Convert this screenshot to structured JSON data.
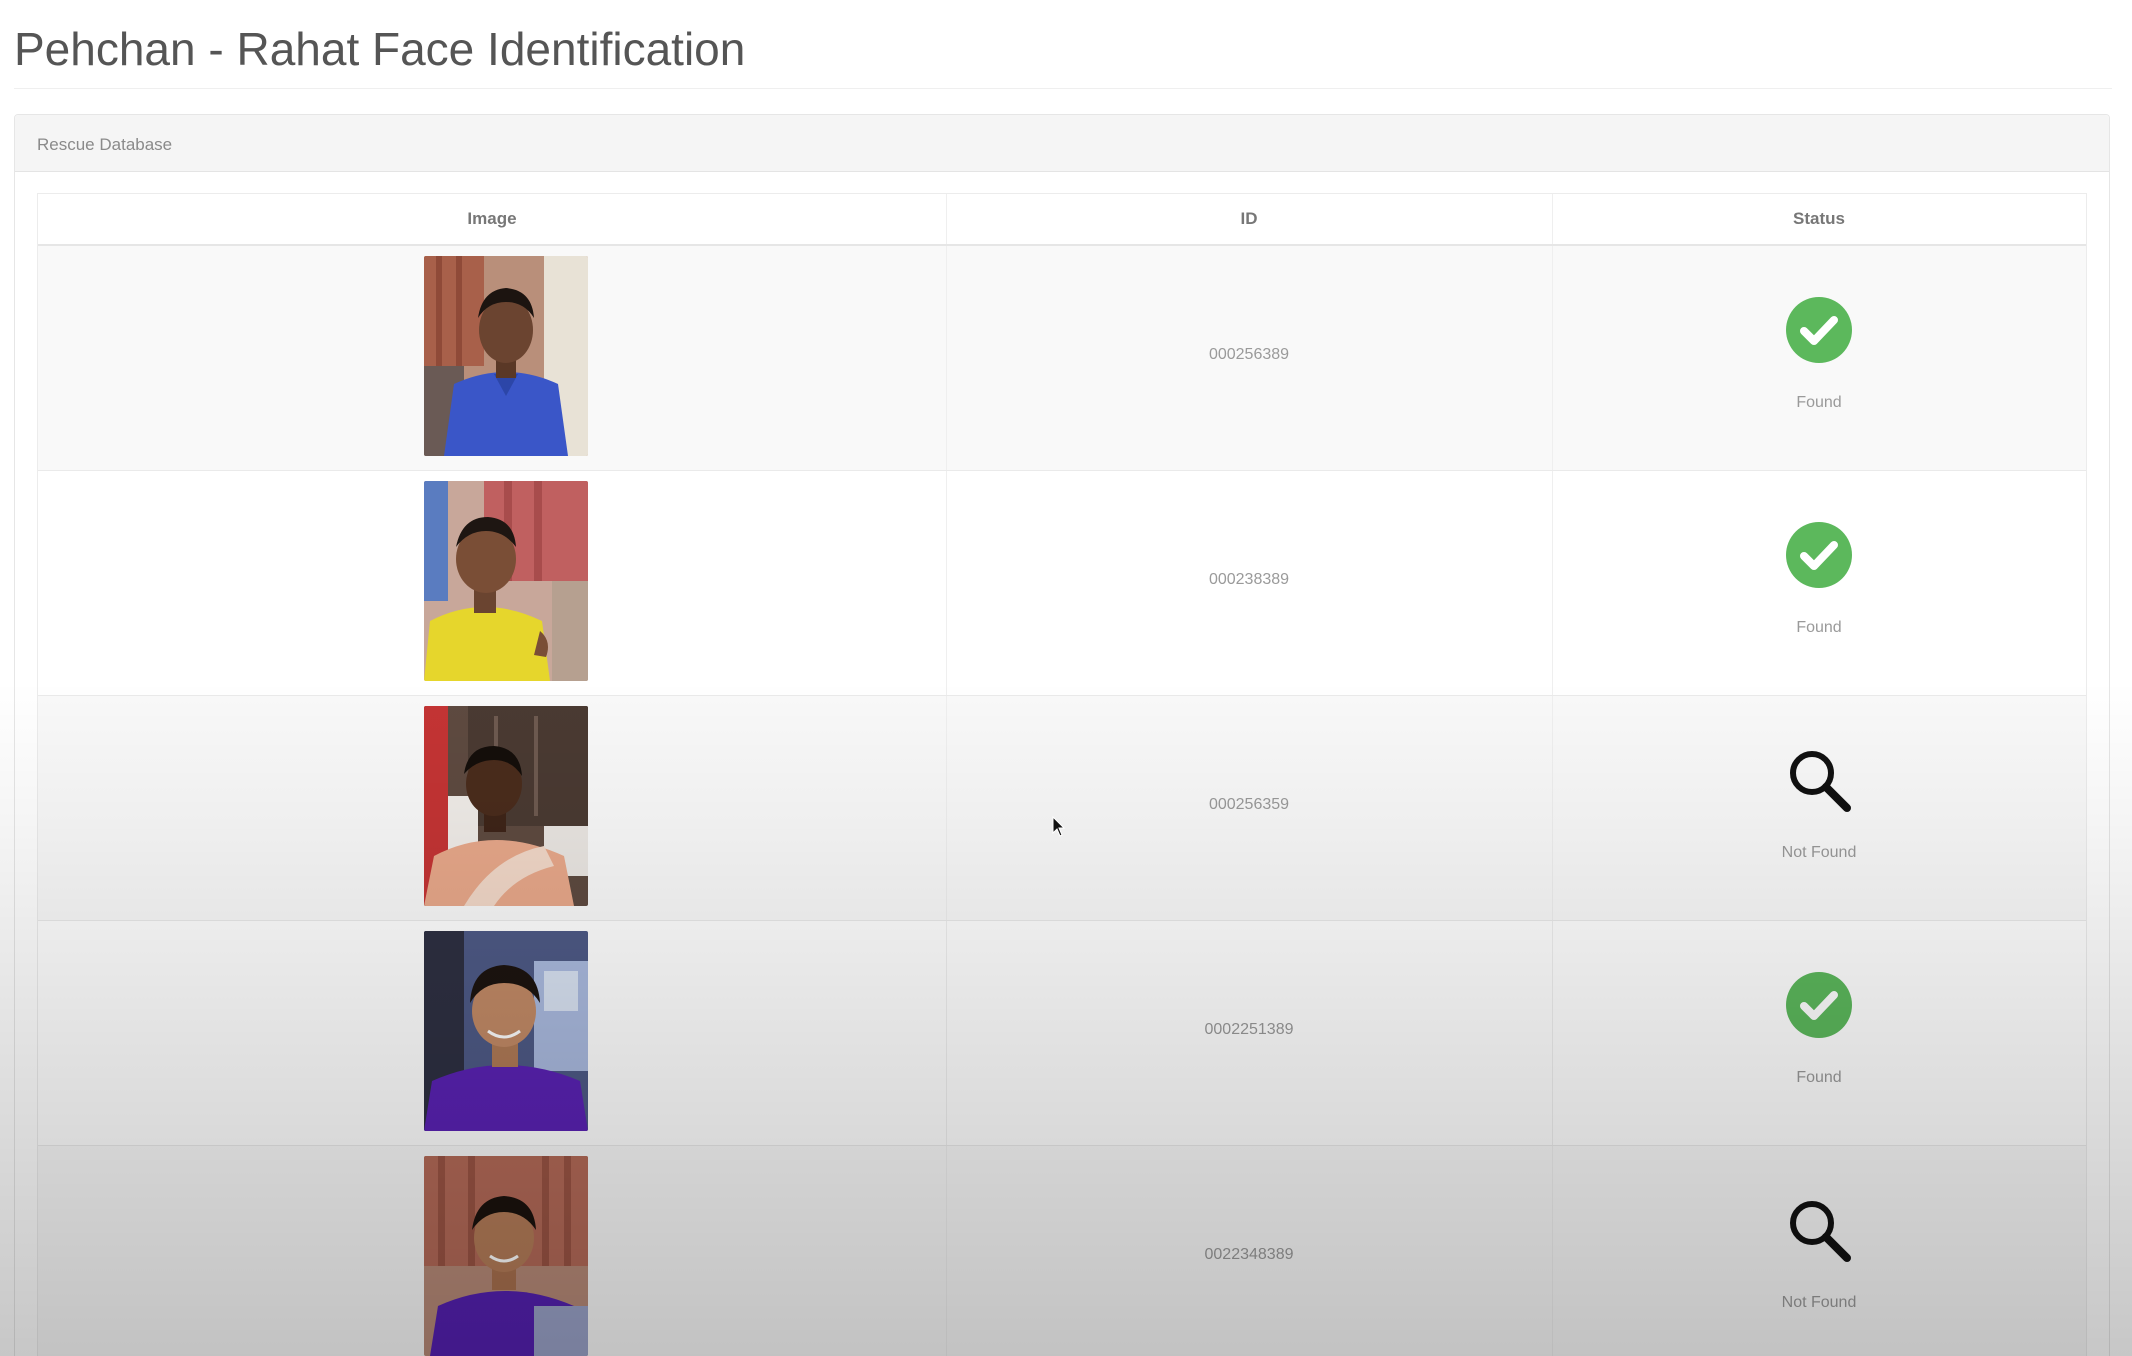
{
  "page": {
    "title": "Pehchan - Rahat Face Identification"
  },
  "panel": {
    "heading": "Rescue Database"
  },
  "table": {
    "columns": [
      "Image",
      "ID",
      "Status"
    ],
    "rows": [
      {
        "id": "000256389",
        "status": "Found",
        "status_icon": "check-circle-icon",
        "photo": "person-blue-shirt"
      },
      {
        "id": "000238389",
        "status": "Found",
        "status_icon": "check-circle-icon",
        "photo": "person-yellow-shirt"
      },
      {
        "id": "000256359",
        "status": "Not Found",
        "status_icon": "magnifier-icon",
        "photo": "person-saree"
      },
      {
        "id": "0002251389",
        "status": "Found",
        "status_icon": "check-circle-icon",
        "photo": "person-purple-shirt"
      },
      {
        "id": "0022348389",
        "status": "Not Found",
        "status_icon": "magnifier-icon",
        "photo": "person-purple-shirt-2"
      }
    ]
  },
  "colors": {
    "found_green": "#5cb85c",
    "title_gray": "#555555"
  }
}
